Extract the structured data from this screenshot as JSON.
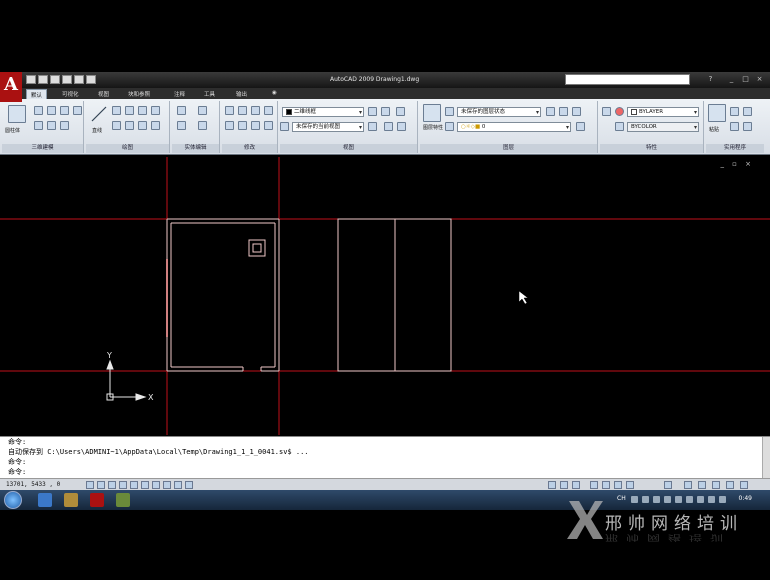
{
  "window": {
    "title": "AutoCAD 2009  Drawing1.dwg",
    "controls": [
      "_",
      "□",
      "×"
    ]
  },
  "tabs": [
    {
      "label": "默认",
      "active": true
    },
    {
      "label": "可视化",
      "active": false
    },
    {
      "label": "视图",
      "active": false
    },
    {
      "label": "块和参照",
      "active": false
    },
    {
      "label": "注释",
      "active": false
    },
    {
      "label": "工具",
      "active": false
    },
    {
      "label": "输出",
      "active": false
    }
  ],
  "ribbon": {
    "panels": [
      {
        "label": "三维建模",
        "tool": "圆柱体"
      },
      {
        "label": "绘图",
        "tool": "直线"
      },
      {
        "label": "实体编辑"
      },
      {
        "label": "修改"
      },
      {
        "label": "视图",
        "visual_style": "二维线框",
        "saved_view": "未保存的当前视图"
      },
      {
        "label": "图层",
        "layer_state": "未保存的图层状态",
        "current_layer": "0",
        "tool": "图层特性"
      },
      {
        "label": "特性",
        "color": "BYLAYER",
        "linetype": "BYCOLOR"
      },
      {
        "label": "实用程序",
        "tool": "粘贴"
      }
    ]
  },
  "viewport_controls": "_ ▫ ×",
  "ucs": {
    "x_label": "X",
    "y_label": "Y"
  },
  "command_line": {
    "lines": [
      "命令:",
      "自动保存到 C:\\Users\\ADMINI~1\\AppData\\Local\\Temp\\Drawing1_1_1_0041.sv$ ...",
      "命令:",
      "命令:"
    ]
  },
  "status": {
    "coords": "13701, 5433 , 0"
  },
  "taskbar": {
    "lang": "CH",
    "clock": "0:49"
  },
  "watermark": {
    "text": "邢帅网络培训"
  },
  "colors": {
    "guide_line": "#c0101a",
    "geometry": "#f0c8c8",
    "ribbon_bg": "#e3e9ef"
  }
}
